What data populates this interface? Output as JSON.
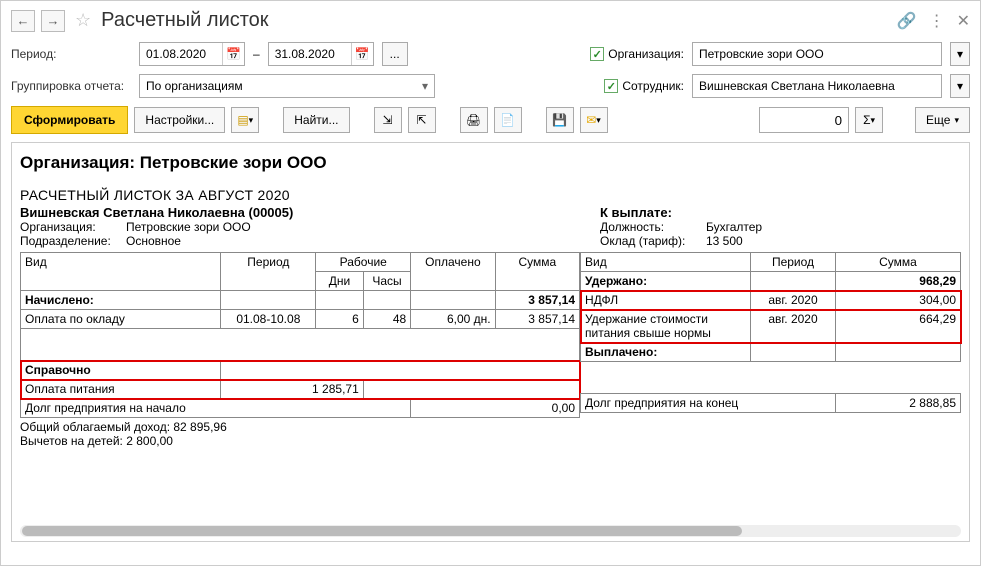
{
  "window": {
    "title": "Расчетный листок"
  },
  "params": {
    "period_label": "Период:",
    "date_from": "01.08.2020",
    "date_dash": "–",
    "date_to": "31.08.2020",
    "dots": "...",
    "org_label": "Организация:",
    "org_value": "Петровские зори ООО",
    "group_label": "Группировка отчета:",
    "group_value": "По организациям",
    "emp_label": "Сотрудник:",
    "emp_value": "Вишневская Светлана Николаевна"
  },
  "toolbar": {
    "form": "Сформировать",
    "settings": "Настройки...",
    "find": "Найти...",
    "more": "Еще",
    "num_value": "0",
    "sigma": "Σ"
  },
  "report": {
    "org_header": "Организация: Петровские зори ООО",
    "doc_title": "РАСЧЕТНЫЙ ЛИСТОК ЗА АВГУСТ 2020",
    "employee": "Вишневская Светлана Николаевна (00005)",
    "left_info": {
      "org_k": "Организация:",
      "org_v": "Петровские зори ООО",
      "dep_k": "Подразделение:",
      "dep_v": "Основное"
    },
    "right_info": {
      "pay_k": "К выплате:",
      "post_k": "Должность:",
      "post_v": "Бухгалтер",
      "rate_k": "Оклад (тариф):",
      "rate_v": "13 500"
    },
    "head_left": {
      "vid": "Вид",
      "period": "Период",
      "rab": "Рабочие",
      "dni": "Дни",
      "chasy": "Часы",
      "opl": "Оплачено",
      "sum": "Сумма"
    },
    "head_right": {
      "vid": "Вид",
      "period": "Период",
      "sum": "Сумма"
    },
    "accrued": {
      "label": "Начислено:",
      "total": "3 857,14"
    },
    "accrued_rows": [
      {
        "vid": "Оплата по окладу",
        "period": "01.08-10.08",
        "dni": "6",
        "chasy": "48",
        "opl": "6,00 дн.",
        "sum": "3 857,14"
      }
    ],
    "deducted": {
      "label": "Удержано:",
      "total": "968,29"
    },
    "deducted_rows": [
      {
        "vid": "НДФЛ",
        "period": "авг. 2020",
        "sum": "304,00"
      },
      {
        "vid": "Удержание стоимости питания свыше нормы",
        "period": "авг. 2020",
        "sum": "664,29"
      }
    ],
    "paid_label": "Выплачено:",
    "ref_label": "Справочно",
    "ref_rows": [
      {
        "vid": "Оплата питания",
        "sum": "1 285,71"
      }
    ],
    "debt_start": {
      "label": "Долг предприятия на начало",
      "val": "0,00"
    },
    "debt_end": {
      "label": "Долг предприятия на конец",
      "val": "2 888,85"
    },
    "footer1": "Общий облагаемый доход: 82 895,96",
    "footer2": "Вычетов на детей: 2 800,00"
  }
}
